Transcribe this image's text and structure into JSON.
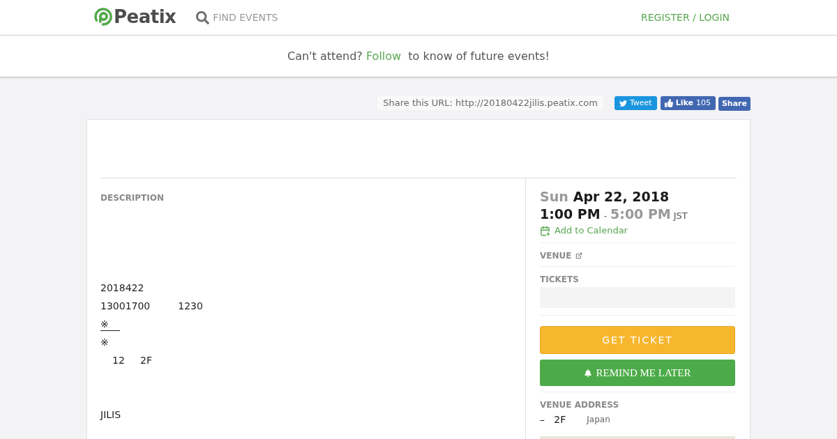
{
  "header": {
    "logo": "Peatix",
    "search": {
      "placeholder": "FIND EVENTS"
    },
    "account_link": "REGISTER / LOGIN"
  },
  "follow_banner": {
    "text_before": "Can't attend?",
    "link": "Follow",
    "text_after": "to know of future events!"
  },
  "share_bar": {
    "url_label": "Share this URL: http://20180422jilis.peatix.com",
    "buttons": [
      {
        "kind": "tweet",
        "label": "Tweet"
      },
      {
        "kind": "like",
        "label": "Like",
        "count": "105"
      },
      {
        "kind": "share",
        "label": "Share"
      }
    ]
  },
  "description": {
    "heading": "DESCRIPTION",
    "paragraphs": [
      {
        "lines": [
          {
            "text": "2018422",
            "underlined": false,
            "indented": false
          },
          {
            "text": "13001700         1230",
            "underlined": false,
            "indented": false
          },
          {
            "text": "※",
            "underlined": true,
            "indented": false
          },
          {
            "text": "※",
            "underlined": false,
            "indented": false
          },
          {
            "text": "12     2F",
            "underlined": false,
            "indented": true
          }
        ]
      },
      {
        "lines": [
          {
            "text": "JILIS",
            "underlined": false,
            "indented": false
          }
        ]
      }
    ]
  },
  "event_info": {
    "date": {
      "weekday": "Sun",
      "date": "Apr 22, 2018"
    },
    "time": {
      "start": "1:00 PM",
      "separator": "-",
      "end": "5:00 PM",
      "timezone": "JST"
    },
    "calendar_link": "Add to Calendar",
    "venue_heading": "VENUE",
    "tickets_heading": "TICKETS",
    "buttons": [
      {
        "kind": "get_ticket",
        "label": "GET TICKET"
      },
      {
        "kind": "remind",
        "label": "REMIND ME LATER"
      }
    ],
    "venue_address": {
      "heading": "VENUE ADDRESS",
      "line": "–   2F",
      "country": "Japan"
    }
  }
}
